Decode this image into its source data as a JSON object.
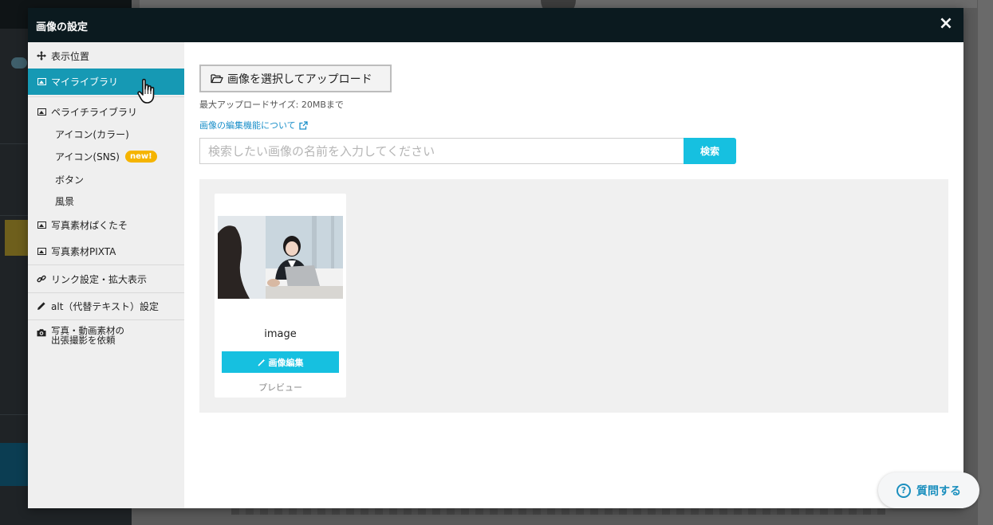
{
  "modal": {
    "title": "画像の設定",
    "close_label": "×"
  },
  "nav": {
    "items": [
      {
        "label": "表示位置",
        "icon": "move-icon"
      },
      {
        "label": "マイライブラリ",
        "icon": "image-icon",
        "active": true
      },
      {
        "label": "ペライチライブラリ",
        "icon": "image-icon"
      },
      {
        "label": "写真素材ぱくたそ",
        "icon": "image-icon"
      },
      {
        "label": "写真素材PIXTA",
        "icon": "image-icon"
      },
      {
        "label": "リンク設定・拡大表示",
        "icon": "link-icon"
      },
      {
        "label": "alt（代替テキスト）設定",
        "icon": "pencil-icon"
      },
      {
        "label": "写真・動画素材の",
        "label2": "出張撮影を依頼",
        "icon": "camera-icon"
      }
    ],
    "sub_items": [
      {
        "label": "アイコン(カラー)"
      },
      {
        "label": "アイコン(SNS)",
        "badge": "new!"
      },
      {
        "label": "ボタン"
      },
      {
        "label": "風景"
      }
    ]
  },
  "content": {
    "upload_button": "画像を選択してアップロード",
    "max_size": "最大アップロードサイズ: 20MBまで",
    "edit_link": "画像の編集機能について",
    "search_placeholder": "検索したい画像の名前を入力してください",
    "search_button": "検索"
  },
  "gallery": {
    "cards": [
      {
        "name": "image",
        "edit_label": "画像編集",
        "preview_label": "プレビュー"
      }
    ]
  },
  "help": {
    "label": "質問する"
  },
  "colors": {
    "accent": "#16c0e0",
    "active_nav": "#1699b4",
    "header": "#0b1a1f",
    "badge": "#f5b400"
  }
}
